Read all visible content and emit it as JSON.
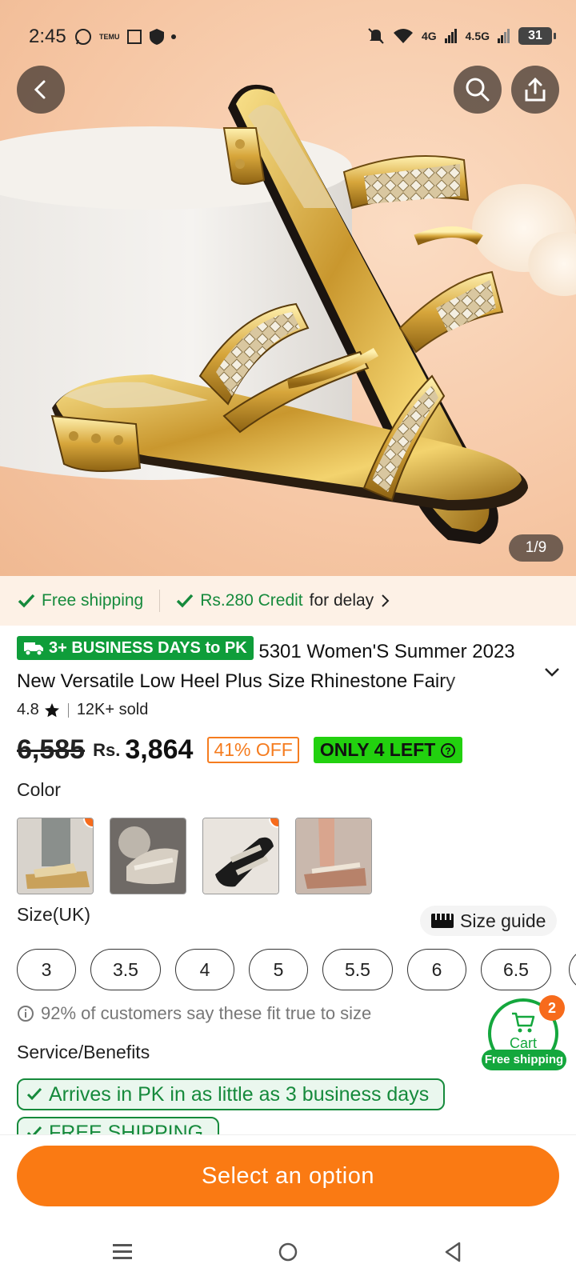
{
  "status": {
    "time": "2:45",
    "temu": "TEMU",
    "net1": "4G",
    "net2": "4.5G",
    "battery": "31"
  },
  "gallery": {
    "indicator": "1/9",
    "image_alt": "Gold metallic rhinestone low heel sandals on white pedestal"
  },
  "shipping_strip": {
    "free_shipping": "Free shipping",
    "credit": "Rs.280 Credit",
    "credit_suffix": "for delay"
  },
  "product": {
    "delivery_badge": "3+ BUSINESS DAYS to PK",
    "title_line1": "5301 Women'S Summer 2023",
    "title_line2": "New Versatile Low Heel Plus Size Rhinestone Fairy",
    "rating": "4.8",
    "sold": "12K+ sold",
    "old_price": "6,585",
    "currency": "Rs.",
    "price": "3,864",
    "discount": "41% OFF",
    "stock": "ONLY 4 LEFT"
  },
  "color": {
    "label": "Color",
    "swatches": [
      {
        "name": "gold-grey",
        "hot": true
      },
      {
        "name": "silver",
        "hot": false
      },
      {
        "name": "black",
        "hot": true
      },
      {
        "name": "rose-gold",
        "hot": false
      }
    ]
  },
  "size": {
    "label": "Size(UK)",
    "guide": "Size guide",
    "options": [
      "3",
      "3.5",
      "4",
      "5",
      "5.5",
      "6",
      "6.5"
    ],
    "fit_note": "92% of customers say these fit true to size"
  },
  "service": {
    "label": "Service/Benefits",
    "items": [
      "Arrives in PK in as little as 3 business days",
      "FREE SHIPPING"
    ]
  },
  "cart": {
    "label": "Cart",
    "count": "2",
    "free_shipping": "Free shipping"
  },
  "cta": {
    "label": "Select an option"
  },
  "colors": {
    "accent": "#fa7a13",
    "green": "#168a3c",
    "stock_green": "#22d10f"
  }
}
